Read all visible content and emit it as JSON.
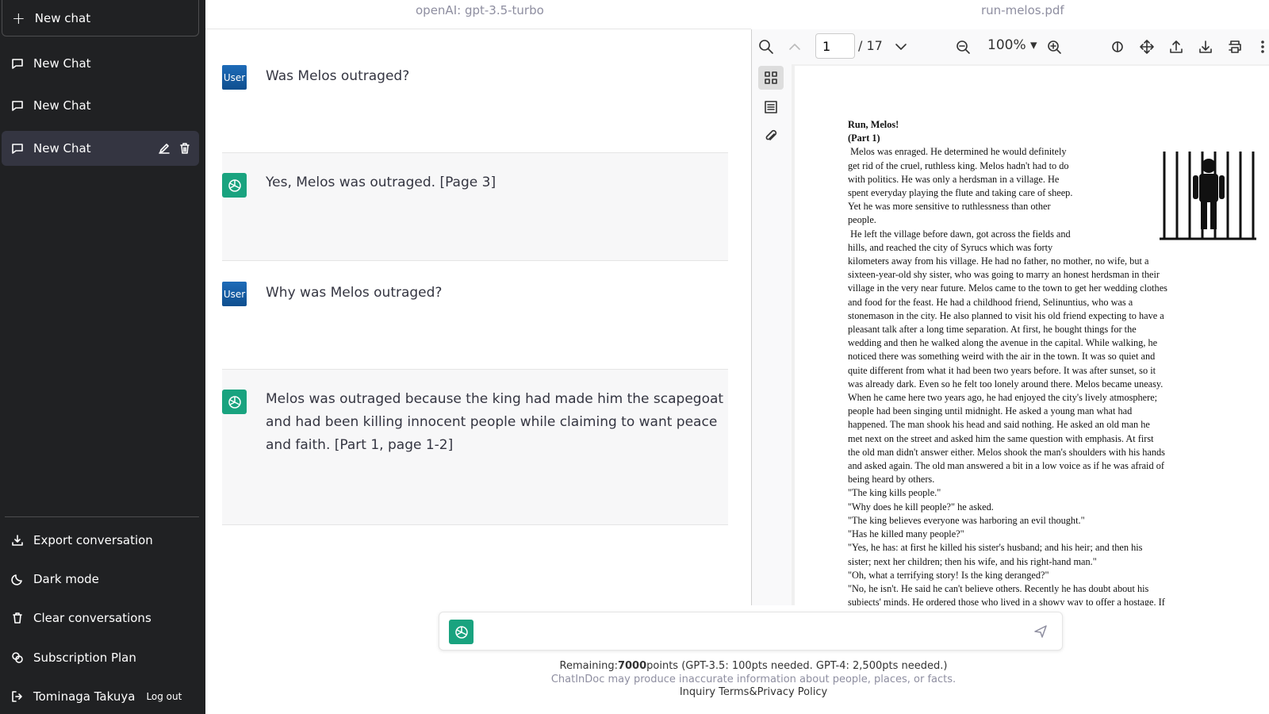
{
  "sidebar": {
    "new_chat": "New chat",
    "chats": [
      {
        "label": "New Chat"
      },
      {
        "label": "New Chat"
      },
      {
        "label": "New Chat"
      }
    ],
    "actions": {
      "export": "Export conversation",
      "dark": "Dark mode",
      "clear": "Clear conversations",
      "plan": "Subscription Plan",
      "user": "Tominaga Takuya",
      "logout": "Log out"
    }
  },
  "header": {
    "model": "openAI: gpt-3.5-turbo",
    "pdf_name": "run-melos.pdf"
  },
  "messages": [
    {
      "role": "User",
      "text": "Was Melos outraged?"
    },
    {
      "role": "assistant",
      "text": "Yes, Melos was outraged. [Page 3]"
    },
    {
      "role": "User",
      "text": "Why was Melos outraged?"
    },
    {
      "role": "assistant",
      "text": "Melos was outraged because the king had made him the scapegoat and had been killing innocent people while claiming to want peace and faith. [Part 1, page 1-2]"
    }
  ],
  "input": {
    "placeholder": ""
  },
  "footer": {
    "remaining_label": "Remaining:",
    "remaining_value": "7000",
    "remaining_suffix": "points (GPT-3.5: 100pts needed. GPT-4: 2,500pts needed.)",
    "disclaimer": "ChatInDoc may produce inaccurate information about people, places, or facts.",
    "inquiry": "Inquiry",
    "terms": "Terms&Privacy Policy"
  },
  "pdf": {
    "page": "1",
    "total": "/ 17",
    "zoom": "100% ▾",
    "title": "Run, Melos!",
    "part": "(Part 1)",
    "lines": [
      " Melos was enraged. He determined he would definitely",
      "get rid of the cruel, ruthless king. Melos hadn't had to do",
      "with politics. He was only a herdsman in a village. He",
      "spent everyday playing the flute and taking care of sheep.",
      "Yet he was more sensitive to ruthlessness than other",
      "people.",
      " He left the village before dawn, got across the fields and",
      "hills, and reached the city of Syrucs which was forty",
      "kilometers away from his village. He had no father, no mother, no wife, but a",
      "sixteen-year-old shy sister, who was going to marry an honest herdsman in their",
      "village in the very near future. Melos came to the town to get her wedding clothes",
      "and food for the feast. He had a childhood friend, Selinuntius, who was a",
      "stonemason in the city. He also planned to visit his old friend expecting to have a",
      "pleasant talk after a long time separation. At first, he bought things for the",
      "wedding and then he walked along the avenue in the capital. While walking, he",
      "noticed there was something weird with the air in the town. It was so quiet and",
      "quite different from what it had been two years before. It was after sunset, so it",
      "was already dark. Even so he felt too lonely around there. Melos became uneasy.",
      "When he came here two years ago, he had enjoyed the city's lively atmosphere;",
      "people had been singing until midnight. He asked a young man what had",
      "happened. The man shook his head and said nothing. He asked an old man he",
      "met next on the street and asked him the same question with emphasis. At first",
      "the old man didn't answer either. Melos shook the man's shoulders with his hands",
      "and asked again. The old man answered a bit in a low voice as if he was afraid of",
      "being heard by others.",
      "\"The king kills people.\"",
      "\"Why does he kill people?\" he asked.",
      "\"The king believes everyone was harboring an evil thought.\"",
      "\"Has he killed many people?\"",
      "\"Yes, he has: at first he killed his sister's husband; and his heir; and then his",
      "sister; next her children; then his wife, and his right-hand man.\"",
      "\"Oh, what a terrifying story! Is the king deranged?\"",
      "\"No, he isn't. He said he can't believe others. Recently he has doubt about his",
      "subjects' minds. He ordered those who lived in a showy way to offer a hostage. If"
    ]
  }
}
